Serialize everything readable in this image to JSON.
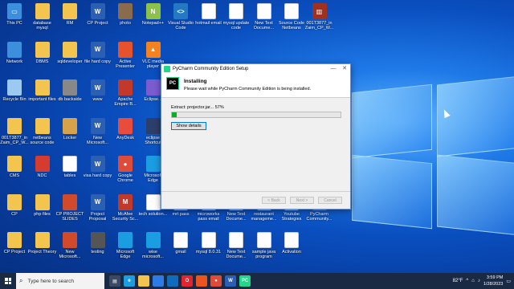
{
  "desktop_icons": [
    {
      "label": "This PC",
      "color": "#3c8fdc",
      "glyph": "▭",
      "col": 0,
      "row": 0
    },
    {
      "label": "database mysql",
      "color": "#f3c44e",
      "glyph": "",
      "col": 1,
      "row": 0
    },
    {
      "label": "RM",
      "color": "#f3c44e",
      "glyph": "",
      "col": 2,
      "row": 0
    },
    {
      "label": "CP Project",
      "color": "#2b5fb4",
      "glyph": "W",
      "col": 3,
      "row": 0
    },
    {
      "label": "photo",
      "color": "#8a6b4e",
      "glyph": "",
      "col": 4,
      "row": 0
    },
    {
      "label": "Notepad++",
      "color": "#8bc34a",
      "glyph": "N",
      "col": 5,
      "row": 0
    },
    {
      "label": "Visual Studio Code",
      "color": "#2479c4",
      "glyph": "<>",
      "col": 6,
      "row": 0
    },
    {
      "label": "hotmail email",
      "color": "#ffffff",
      "glyph": "",
      "col": 7,
      "row": 0
    },
    {
      "label": "mysql update code",
      "color": "#ffffff",
      "glyph": "",
      "col": 8,
      "row": 0
    },
    {
      "label": "New Text Docume...",
      "color": "#ffffff",
      "glyph": "",
      "col": 9,
      "row": 0
    },
    {
      "label": "Source Code Netbeans",
      "color": "#ffffff",
      "glyph": "",
      "col": 10,
      "row": 0
    },
    {
      "label": "001T3877_in Zaim_CP_W...",
      "color": "#a0311e",
      "glyph": "▥",
      "col": 11,
      "row": 0
    },
    {
      "label": "Network",
      "color": "#3c8fdc",
      "glyph": "",
      "col": 0,
      "row": 1
    },
    {
      "label": "DBMS",
      "color": "#f3c44e",
      "glyph": "",
      "col": 1,
      "row": 1
    },
    {
      "label": "sqldeveloper",
      "color": "#f3c44e",
      "glyph": "",
      "col": 2,
      "row": 1
    },
    {
      "label": "file hard copy",
      "color": "#2b5fb4",
      "glyph": "W",
      "col": 3,
      "row": 1
    },
    {
      "label": "Active Presenter",
      "color": "#e5532d",
      "glyph": "",
      "col": 4,
      "row": 1
    },
    {
      "label": "VLC media player",
      "color": "#f58220",
      "glyph": "▲",
      "col": 5,
      "row": 1
    },
    {
      "label": "Recycle Bin",
      "color": "#9cc9ef",
      "glyph": "",
      "col": 0,
      "row": 2
    },
    {
      "label": "important files",
      "color": "#f3c44e",
      "glyph": "",
      "col": 1,
      "row": 2
    },
    {
      "label": "db backside",
      "color": "#888888",
      "glyph": "",
      "col": 2,
      "row": 2
    },
    {
      "label": "www",
      "color": "#2b5fb4",
      "glyph": "W",
      "col": 3,
      "row": 2
    },
    {
      "label": "Apache Empire B...",
      "color": "#c0392b",
      "glyph": "",
      "col": 4,
      "row": 2
    },
    {
      "label": "Eclipse...",
      "color": "#7a5cd0",
      "glyph": "",
      "col": 5,
      "row": 2
    },
    {
      "label": "001T3877_in Zaim_CP_W...",
      "color": "#f3c44e",
      "glyph": "",
      "col": 0,
      "row": 3
    },
    {
      "label": "netbeans source code",
      "color": "#f3c44e",
      "glyph": "",
      "col": 1,
      "row": 3
    },
    {
      "label": "Locker",
      "color": "#d6a24a",
      "glyph": "",
      "col": 2,
      "row": 3
    },
    {
      "label": "New Microsoft...",
      "color": "#2b5fb4",
      "glyph": "W",
      "col": 3,
      "row": 3
    },
    {
      "label": "AnyDesk",
      "color": "#e74c3c",
      "glyph": "",
      "col": 4,
      "row": 3
    },
    {
      "label": "eclipse Shortcut",
      "color": "#2c3e6a",
      "glyph": "",
      "col": 5,
      "row": 3
    },
    {
      "label": "CMS",
      "color": "#f3c44e",
      "glyph": "",
      "col": 0,
      "row": 4
    },
    {
      "label": "NDC",
      "color": "#d33c2f",
      "glyph": "",
      "col": 1,
      "row": 4
    },
    {
      "label": "tables",
      "color": "#ffffff",
      "glyph": "",
      "col": 2,
      "row": 4
    },
    {
      "label": "visa hard copy",
      "color": "#2b5fb4",
      "glyph": "W",
      "col": 3,
      "row": 4
    },
    {
      "label": "Google Chrome",
      "color": "#dd4b39",
      "glyph": "●",
      "col": 4,
      "row": 4
    },
    {
      "label": "Microsoft Edge",
      "color": "#1b9de2",
      "glyph": "",
      "col": 5,
      "row": 4
    },
    {
      "label": "CP",
      "color": "#f3c44e",
      "glyph": "",
      "col": 0,
      "row": 5
    },
    {
      "label": "php files",
      "color": "#f3c44e",
      "glyph": "",
      "col": 1,
      "row": 5
    },
    {
      "label": "CP PROJECT SLIDES",
      "color": "#d04a2b",
      "glyph": "",
      "col": 2,
      "row": 5
    },
    {
      "label": "Project Proposal",
      "color": "#2b5fb4",
      "glyph": "W",
      "col": 3,
      "row": 5
    },
    {
      "label": "McAfee Security Sc...",
      "color": "#c0392b",
      "glyph": "M",
      "col": 4,
      "row": 5
    },
    {
      "label": "tech solution...",
      "color": "#ffffff",
      "glyph": "",
      "col": 5,
      "row": 5
    },
    {
      "label": "CP Project",
      "color": "#f3c44e",
      "glyph": "",
      "col": 0,
      "row": 6
    },
    {
      "label": "Project Theory",
      "color": "#f3c44e",
      "glyph": "",
      "col": 1,
      "row": 6
    },
    {
      "label": "New Microsoft...",
      "color": "#d04a2b",
      "glyph": "",
      "col": 2,
      "row": 6
    },
    {
      "label": "testing",
      "color": "#555555",
      "glyph": "",
      "col": 3,
      "row": 6
    },
    {
      "label": "Microsoft Edge",
      "color": "#1b9de2",
      "glyph": "",
      "col": 4,
      "row": 6
    },
    {
      "label": "wise microsoft...",
      "color": "#1b9de2",
      "glyph": "",
      "col": 5,
      "row": 6
    },
    {
      "label": "gmail",
      "color": "#ffffff",
      "glyph": "",
      "col": 6,
      "row": 6
    },
    {
      "label": "mysql 8.0.31",
      "color": "#ffffff",
      "glyph": "",
      "col": 7,
      "row": 6
    },
    {
      "label": "New Text Docume...",
      "color": "#ffffff",
      "glyph": "",
      "col": 8,
      "row": 6
    },
    {
      "label": "sample java program",
      "color": "#ffffff",
      "glyph": "",
      "col": 9,
      "row": 6
    },
    {
      "label": "Activation",
      "color": "#ffffff",
      "glyph": "",
      "col": 10,
      "row": 6
    },
    {
      "label": "mrt pass",
      "color": "#ffffff",
      "glyph": "",
      "col": 6,
      "row": 5
    },
    {
      "label": "microworks pass email",
      "color": "#ffffff",
      "glyph": "",
      "col": 7,
      "row": 5
    },
    {
      "label": "New Text Docume...",
      "color": "#ffffff",
      "glyph": "",
      "col": 8,
      "row": 5
    },
    {
      "label": "restaurant manageme...",
      "color": "#ffffff",
      "glyph": "",
      "col": 9,
      "row": 5
    },
    {
      "label": "Youtube Strategies",
      "color": "#ffffff",
      "glyph": "",
      "col": 10,
      "row": 5
    },
    {
      "label": "PyCharm Community...",
      "color": "#21d789",
      "glyph": "PC",
      "col": 11,
      "row": 5
    }
  ],
  "dialog": {
    "title": "PyCharm Community Edition Setup",
    "logo": "PC",
    "heading": "Installing",
    "subtitle": "Please wait while PyCharm Community Edition is being installed.",
    "extract_text": "Extract: projector.jar... 57%",
    "progress": 0.03,
    "show_details": "Show details",
    "back": "< Back",
    "next": "Next >",
    "cancel": "Cancel",
    "minimize": "—",
    "close": "✕"
  },
  "taskbar": {
    "search_placeholder": "Type here to search",
    "weather": "82°F",
    "time": "3:59 PM",
    "date": "1/28/2023",
    "apps": [
      {
        "name": "task-view",
        "color": "#3a4a66",
        "glyph": "▤"
      },
      {
        "name": "edge",
        "color": "#1b9de2",
        "glyph": "e"
      },
      {
        "name": "file-explorer",
        "color": "#f3c44e",
        "glyph": ""
      },
      {
        "name": "store",
        "color": "#2d7be5",
        "glyph": ""
      },
      {
        "name": "mail",
        "color": "#0f6cbd",
        "glyph": ""
      },
      {
        "name": "opera",
        "color": "#e3232e",
        "glyph": "O"
      },
      {
        "name": "recorder",
        "color": "#e95420",
        "glyph": ""
      },
      {
        "name": "chrome",
        "color": "#dd4b39",
        "glyph": "●"
      },
      {
        "name": "word",
        "color": "#2b5fb4",
        "glyph": "W"
      },
      {
        "name": "pycharm",
        "color": "#21d789",
        "glyph": "PC"
      }
    ]
  }
}
